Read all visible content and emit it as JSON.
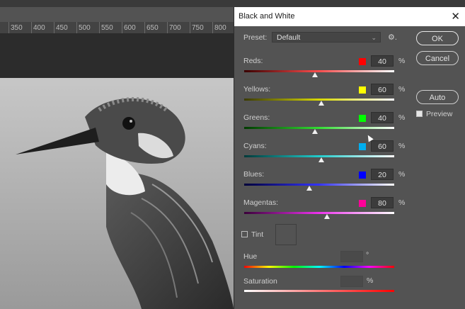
{
  "ruler": {
    "ticks": [
      "350",
      "400",
      "450",
      "500",
      "550",
      "600",
      "650",
      "700",
      "750",
      "800"
    ]
  },
  "dialog": {
    "title": "Black and White",
    "close_glyph": "✕",
    "preset_label": "Preset:",
    "preset_value": "Default",
    "preset_chevron": "⌄",
    "gear_glyph": "⚙.",
    "buttons": {
      "ok": "OK",
      "cancel": "Cancel",
      "auto": "Auto"
    },
    "preview_label": "Preview",
    "preview_checked": true,
    "sliders": [
      {
        "name": "reds",
        "label": "Reds:",
        "value": "40",
        "unit": "%",
        "color": "#ff0000",
        "fill": 0.48
      },
      {
        "name": "yellows",
        "label": "Yellows:",
        "value": "60",
        "unit": "%",
        "color": "#ffff00",
        "fill": 0.52
      },
      {
        "name": "greens",
        "label": "Greens:",
        "value": "40",
        "unit": "%",
        "color": "#00ff00",
        "fill": 0.48
      },
      {
        "name": "cyans",
        "label": "Cyans:",
        "value": "60",
        "unit": "%",
        "color": "#00aeef",
        "fill": 0.52
      },
      {
        "name": "blues",
        "label": "Blues:",
        "value": "20",
        "unit": "%",
        "color": "#0000ff",
        "fill": 0.44
      },
      {
        "name": "magentas",
        "label": "Magentas:",
        "value": "80",
        "unit": "%",
        "color": "#ff0099",
        "fill": 0.56
      }
    ],
    "tint": {
      "label": "Tint",
      "checked": false
    },
    "hue": {
      "label": "Hue",
      "unit": "°"
    },
    "saturation": {
      "label": "Saturation",
      "unit": "%"
    }
  }
}
